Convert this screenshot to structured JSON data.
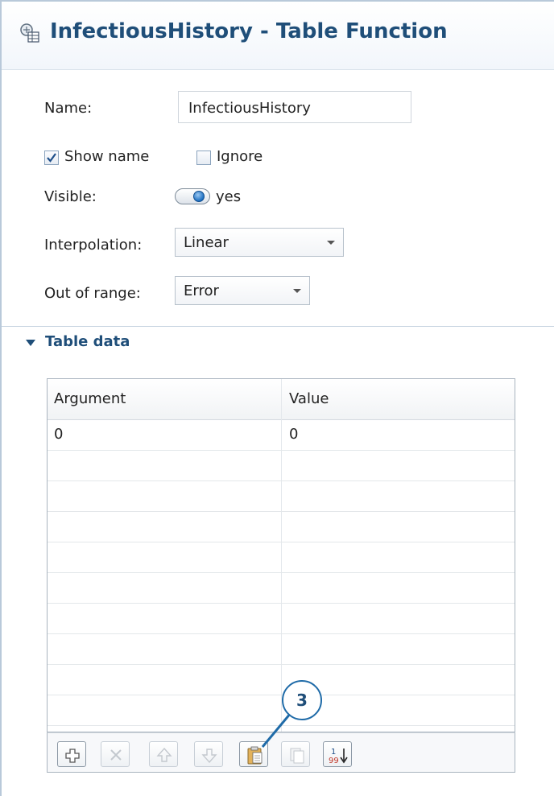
{
  "title": {
    "text": "InfectiousHistory - Table Function",
    "icon": "table-function-icon"
  },
  "properties": {
    "name_label": "Name:",
    "name_value": "InfectiousHistory",
    "show_name": {
      "label": "Show name",
      "checked": true
    },
    "ignore": {
      "label": "Ignore",
      "checked": false
    },
    "visible_label": "Visible:",
    "visible_value": "yes",
    "interpolation_label": "Interpolation:",
    "interpolation_value": "Linear",
    "out_of_range_label": "Out of range:",
    "out_of_range_value": "Error"
  },
  "section": {
    "title": "Table data",
    "expanded": true
  },
  "table": {
    "columns": [
      "Argument",
      "Value"
    ],
    "rows": [
      [
        "0",
        "0"
      ],
      [
        "",
        ""
      ],
      [
        "",
        ""
      ],
      [
        "",
        ""
      ],
      [
        "",
        ""
      ],
      [
        "",
        ""
      ],
      [
        "",
        ""
      ],
      [
        "",
        ""
      ],
      [
        "",
        ""
      ],
      [
        "",
        ""
      ]
    ]
  },
  "toolbar": {
    "buttons": [
      {
        "icon": "add-row-icon",
        "enabled": true
      },
      {
        "icon": "delete-row-icon",
        "enabled": false
      },
      {
        "icon": "move-up-icon",
        "enabled": false
      },
      {
        "icon": "move-down-icon",
        "enabled": false
      },
      {
        "icon": "paste-icon",
        "enabled": true
      },
      {
        "icon": "copy-icon",
        "enabled": false
      },
      {
        "icon": "sort-icon",
        "enabled": true
      }
    ]
  },
  "callout": {
    "label": "3"
  },
  "colors": {
    "title": "#1f4e79",
    "accent": "#1d6fc1",
    "callout_border": "#1f6ba8"
  }
}
